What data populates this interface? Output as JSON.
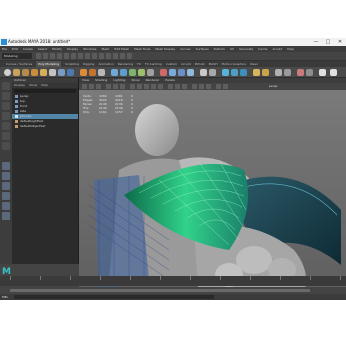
{
  "window": {
    "title": "Autodesk MAYA 2018: untitled*",
    "controls": [
      "—",
      "□",
      "✕"
    ]
  },
  "menubar": [
    "File",
    "Edit",
    "Create",
    "Select",
    "Modify",
    "Display",
    "Windows",
    "Mesh",
    "Edit Mesh",
    "Mesh Tools",
    "Mesh Display",
    "Curves",
    "Surfaces",
    "Deform",
    "UV",
    "Generate",
    "Cache",
    "Arnold",
    "Help"
  ],
  "statusline": {
    "mode": "Modeling"
  },
  "shelf_tabs": {
    "items": [
      "Curves / Surfaces",
      "Poly Modeling",
      "Sculpting",
      "Rigging",
      "Animation",
      "Rendering",
      "FX",
      "FX Caching",
      "Custom",
      "Arnold",
      "Bifrost",
      "MASH",
      "Motion Graphics",
      "XGen"
    ],
    "active": "Poly Modeling"
  },
  "outliner": {
    "title": "Outliner",
    "menu": [
      "Display",
      "Show",
      "Help"
    ],
    "items": [
      {
        "label": "persp",
        "selected": false
      },
      {
        "label": "top",
        "selected": false
      },
      {
        "label": "front",
        "selected": false
      },
      {
        "label": "side",
        "selected": false
      },
      {
        "label": "pCone1",
        "selected": true
      },
      {
        "label": "defaultLightSet",
        "selected": false
      },
      {
        "label": "defaultObjectSet",
        "selected": false
      }
    ]
  },
  "viewport": {
    "menu": [
      "View",
      "Shading",
      "Lighting",
      "Show",
      "Renderer",
      "Panels"
    ],
    "camera_label": "persp",
    "hud": [
      [
        "Verts:",
        "1084",
        "1081",
        "0"
      ],
      [
        "Edges:",
        "3222",
        "3218",
        "0"
      ],
      [
        "Faces:",
        "2140",
        "2136",
        "0"
      ],
      [
        "Tris:",
        "2140",
        "2136",
        "0"
      ],
      [
        "UVs:",
        "1161",
        "1157",
        "0"
      ]
    ]
  },
  "command_line": {
    "label": "MEL"
  },
  "logo": "M",
  "colors": {
    "accent": "#5285a6",
    "wire": "#39d98a",
    "maya_logo": "#39c3c8"
  }
}
